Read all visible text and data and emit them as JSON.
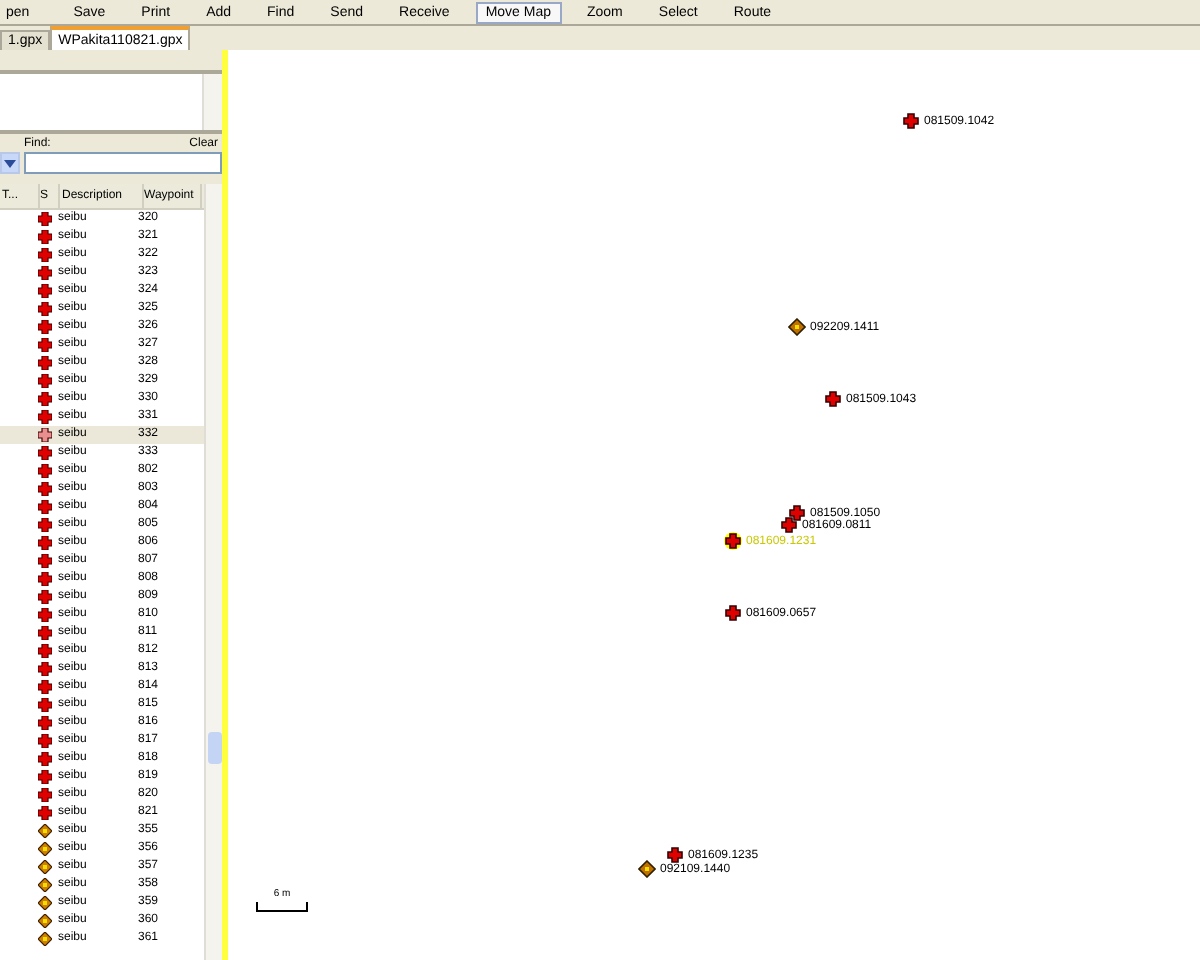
{
  "toolbar": [
    {
      "label": "pen",
      "selected": false
    },
    {
      "label": "Save",
      "selected": false
    },
    {
      "label": "Print",
      "selected": false
    },
    {
      "label": "Add",
      "selected": false
    },
    {
      "label": "Find",
      "selected": false
    },
    {
      "label": "Send",
      "selected": false
    },
    {
      "label": "Receive",
      "selected": false
    },
    {
      "label": "Move Map",
      "selected": true
    },
    {
      "label": "Zoom",
      "selected": false
    },
    {
      "label": "Select",
      "selected": false
    },
    {
      "label": "Route",
      "selected": false
    }
  ],
  "tabs": [
    {
      "label": "1.gpx",
      "selected": false
    },
    {
      "label": "WPakita110821.gpx",
      "selected": true
    }
  ],
  "find": {
    "label": "Find:",
    "clear": "Clear"
  },
  "table": {
    "columns": [
      "T...",
      "S",
      "Description",
      "Waypoint"
    ],
    "rows": [
      {
        "kind": "cross",
        "description": "seibu",
        "waypoint": "320",
        "selected": false
      },
      {
        "kind": "cross",
        "description": "seibu",
        "waypoint": "321",
        "selected": false
      },
      {
        "kind": "cross",
        "description": "seibu",
        "waypoint": "322",
        "selected": false
      },
      {
        "kind": "cross",
        "description": "seibu",
        "waypoint": "323",
        "selected": false
      },
      {
        "kind": "cross",
        "description": "seibu",
        "waypoint": "324",
        "selected": false
      },
      {
        "kind": "cross",
        "description": "seibu",
        "waypoint": "325",
        "selected": false
      },
      {
        "kind": "cross",
        "description": "seibu",
        "waypoint": "326",
        "selected": false
      },
      {
        "kind": "cross",
        "description": "seibu",
        "waypoint": "327",
        "selected": false
      },
      {
        "kind": "cross",
        "description": "seibu",
        "waypoint": "328",
        "selected": false
      },
      {
        "kind": "cross",
        "description": "seibu",
        "waypoint": "329",
        "selected": false
      },
      {
        "kind": "cross",
        "description": "seibu",
        "waypoint": "330",
        "selected": false
      },
      {
        "kind": "cross",
        "description": "seibu",
        "waypoint": "331",
        "selected": false
      },
      {
        "kind": "cross",
        "description": "seibu",
        "waypoint": "332",
        "selected": true
      },
      {
        "kind": "cross",
        "description": "seibu",
        "waypoint": "333",
        "selected": false
      },
      {
        "kind": "cross",
        "description": "seibu",
        "waypoint": "802",
        "selected": false
      },
      {
        "kind": "cross",
        "description": "seibu",
        "waypoint": "803",
        "selected": false
      },
      {
        "kind": "cross",
        "description": "seibu",
        "waypoint": "804",
        "selected": false
      },
      {
        "kind": "cross",
        "description": "seibu",
        "waypoint": "805",
        "selected": false
      },
      {
        "kind": "cross",
        "description": "seibu",
        "waypoint": "806",
        "selected": false
      },
      {
        "kind": "cross",
        "description": "seibu",
        "waypoint": "807",
        "selected": false
      },
      {
        "kind": "cross",
        "description": "seibu",
        "waypoint": "808",
        "selected": false
      },
      {
        "kind": "cross",
        "description": "seibu",
        "waypoint": "809",
        "selected": false
      },
      {
        "kind": "cross",
        "description": "seibu",
        "waypoint": "810",
        "selected": false
      },
      {
        "kind": "cross",
        "description": "seibu",
        "waypoint": "811",
        "selected": false
      },
      {
        "kind": "cross",
        "description": "seibu",
        "waypoint": "812",
        "selected": false
      },
      {
        "kind": "cross",
        "description": "seibu",
        "waypoint": "813",
        "selected": false
      },
      {
        "kind": "cross",
        "description": "seibu",
        "waypoint": "814",
        "selected": false
      },
      {
        "kind": "cross",
        "description": "seibu",
        "waypoint": "815",
        "selected": false
      },
      {
        "kind": "cross",
        "description": "seibu",
        "waypoint": "816",
        "selected": false
      },
      {
        "kind": "cross",
        "description": "seibu",
        "waypoint": "817",
        "selected": false
      },
      {
        "kind": "cross",
        "description": "seibu",
        "waypoint": "818",
        "selected": false
      },
      {
        "kind": "cross",
        "description": "seibu",
        "waypoint": "819",
        "selected": false
      },
      {
        "kind": "cross",
        "description": "seibu",
        "waypoint": "820",
        "selected": false
      },
      {
        "kind": "cross",
        "description": "seibu",
        "waypoint": "821",
        "selected": false
      },
      {
        "kind": "diamond",
        "description": "seibu",
        "waypoint": "355",
        "selected": false
      },
      {
        "kind": "diamond",
        "description": "seibu",
        "waypoint": "356",
        "selected": false
      },
      {
        "kind": "diamond",
        "description": "seibu",
        "waypoint": "357",
        "selected": false
      },
      {
        "kind": "diamond",
        "description": "seibu",
        "waypoint": "358",
        "selected": false
      },
      {
        "kind": "diamond",
        "description": "seibu",
        "waypoint": "359",
        "selected": false
      },
      {
        "kind": "diamond",
        "description": "seibu",
        "waypoint": "360",
        "selected": false
      },
      {
        "kind": "diamond",
        "description": "seibu",
        "waypoint": "361",
        "selected": false
      }
    ]
  },
  "map": {
    "waypoints": [
      {
        "kind": "cross",
        "label": "081509.1042",
        "selected": false
      },
      {
        "kind": "diamond",
        "label": "092209.1411",
        "selected": false
      },
      {
        "kind": "cross",
        "label": "081509.1043",
        "selected": false
      },
      {
        "kind": "cross",
        "label": "081509.1050",
        "selected": false
      },
      {
        "kind": "cross",
        "label": "081609.0811",
        "selected": false
      },
      {
        "kind": "cross",
        "label": "081609.1231",
        "selected": true
      },
      {
        "kind": "cross",
        "label": "081609.0657",
        "selected": false
      },
      {
        "kind": "cross",
        "label": "081609.1235",
        "selected": false
      },
      {
        "kind": "diamond",
        "label": "092109.1440",
        "selected": false
      }
    ],
    "scale": "6 m"
  }
}
